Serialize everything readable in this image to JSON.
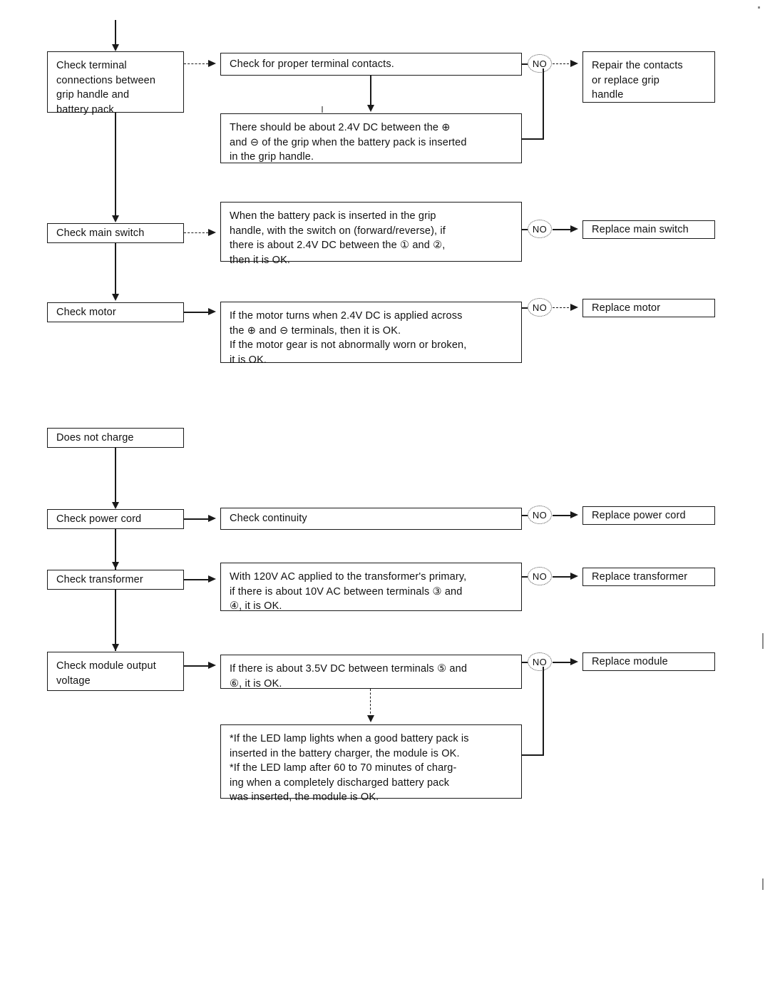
{
  "diagram": {
    "title": "Troubleshooting flowchart",
    "no_label": "NO",
    "section_motor": {
      "checks": [
        {
          "id": "check-terminal-connections",
          "label": "Check terminal\nconnections between\ngrip handle and\nbattery pack"
        },
        {
          "id": "check-main-switch",
          "label": "Check main switch"
        },
        {
          "id": "check-motor",
          "label": "Check motor"
        }
      ],
      "tests": [
        {
          "id": "test-terminal-contacts",
          "label": "Check for proper terminal contacts."
        },
        {
          "id": "test-grip-voltage",
          "label": "There should be about 2.4V DC between the ⊕\nand ⊖ of the grip when the battery pack is inserted\nin the grip handle."
        },
        {
          "id": "test-main-switch-voltage",
          "label": "When the battery pack is inserted in the grip\nhandle, with the switch on (forward/reverse), if\nthere is about 2.4V DC between the ① and ②,\nthen it is OK."
        },
        {
          "id": "test-motor-turns",
          "label": "If the motor turns when 2.4V DC is applied across\nthe ⊕ and ⊖ terminals, then it is OK.\nIf the motor gear is not abnormally worn or broken,\nit is OK."
        }
      ],
      "actions": [
        {
          "id": "repair-contacts",
          "label": "Repair the contacts\nor replace grip\nhandle"
        },
        {
          "id": "replace-main-switch",
          "label": "Replace main switch"
        },
        {
          "id": "replace-motor",
          "label": "Replace motor"
        }
      ]
    },
    "section_charge": {
      "start": {
        "id": "does-not-charge",
        "label": "Does not charge"
      },
      "checks": [
        {
          "id": "check-power-cord",
          "label": "Check power cord"
        },
        {
          "id": "check-transformer",
          "label": "Check transformer"
        },
        {
          "id": "check-module-output-voltage",
          "label": "Check module output\nvoltage"
        }
      ],
      "tests": [
        {
          "id": "test-continuity",
          "label": "Check continuity"
        },
        {
          "id": "test-transformer-voltage",
          "label": "With 120V AC applied to the transformer's primary,\nif there is about 10V AC between terminals ③ and\n④, it is OK."
        },
        {
          "id": "test-module-voltage",
          "label": "If there is about 3.5V DC between terminals ⑤ and\n⑥, it is OK."
        },
        {
          "id": "test-led-lamp",
          "label": "*If the LED lamp lights when a good battery pack is\n inserted in the battery charger, the module is OK.\n*If the LED lamp after 60 to 70 minutes of charg-\n ing when a completely discharged battery pack\n was inserted, the module is OK."
        }
      ],
      "actions": [
        {
          "id": "replace-power-cord",
          "label": "Replace power cord"
        },
        {
          "id": "replace-transformer",
          "label": "Replace transformer"
        },
        {
          "id": "replace-module",
          "label": "Replace module"
        }
      ]
    }
  }
}
